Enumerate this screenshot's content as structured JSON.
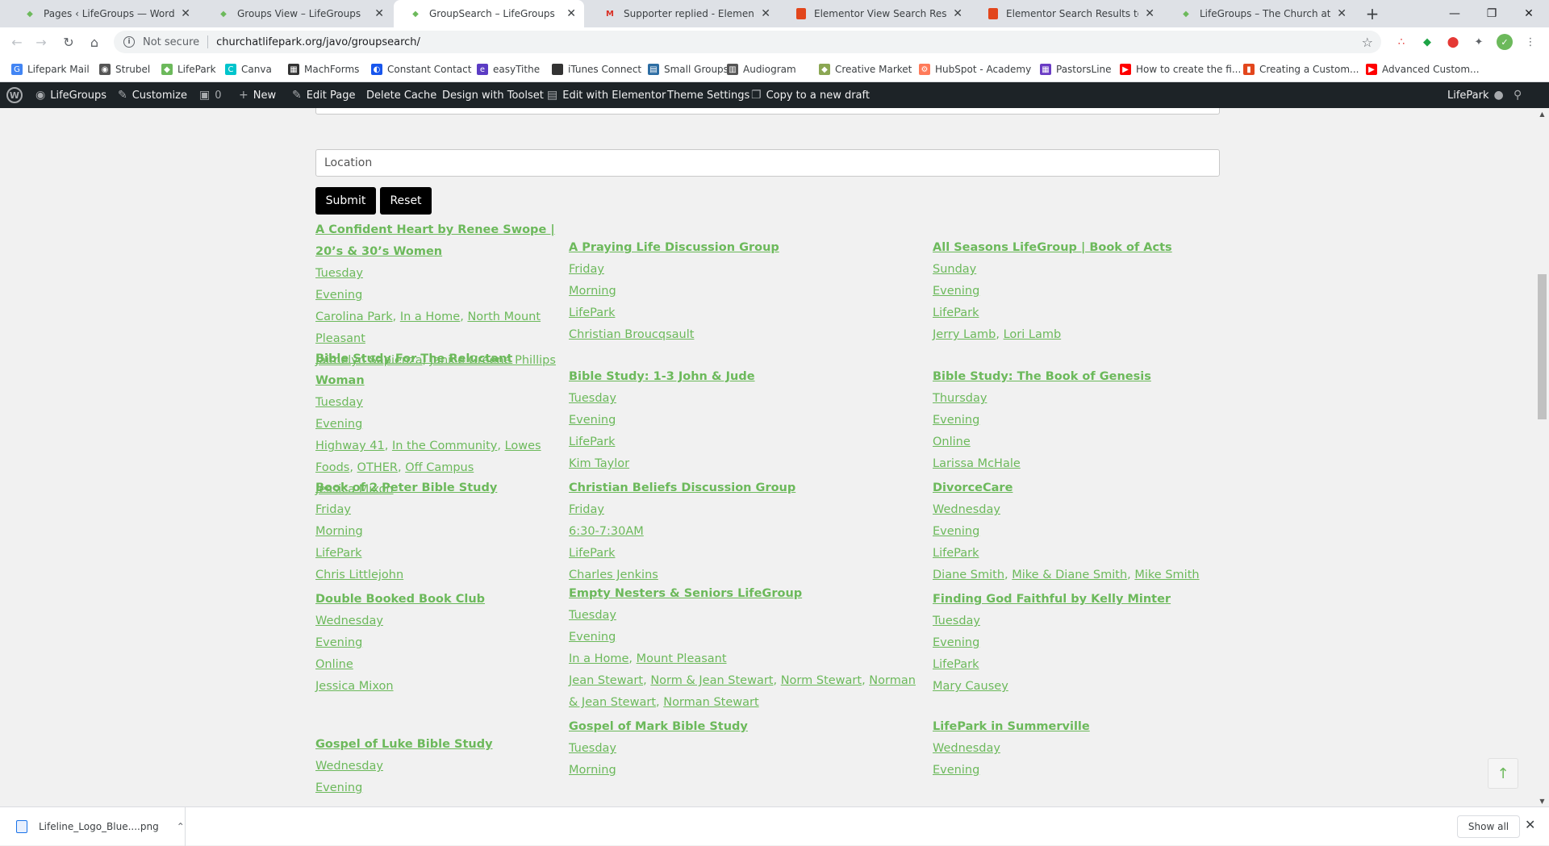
{
  "browser": {
    "tabs": [
      {
        "title": "Pages ‹ LifeGroups — WordPress",
        "icon": "wordpress-icon",
        "active": false
      },
      {
        "title": "Groups View – LifeGroups",
        "icon": "lifepark-icon",
        "active": false
      },
      {
        "title": "GroupSearch – LifeGroups",
        "icon": "lifepark-icon",
        "active": true
      },
      {
        "title": "Supporter replied - Elementor Vi",
        "icon": "gmail-icon",
        "active": false
      },
      {
        "title": "Elementor View Search Results a",
        "icon": "bookmark-red-icon",
        "active": false
      },
      {
        "title": "Elementor Search Results to a ne",
        "icon": "bookmark-red-icon",
        "active": false
      },
      {
        "title": "LifeGroups – The Church at LifeP",
        "icon": "lifepark-icon",
        "active": false
      }
    ],
    "new_tab": "+",
    "security_label": "Not secure",
    "url": "churchatlifepark.org/javo/groupsearch/",
    "bookmarks": [
      {
        "label": "Lifepark Mail",
        "color": "#4285f4",
        "glyph": "G"
      },
      {
        "label": "Strubel",
        "color": "#555555",
        "glyph": "◉"
      },
      {
        "label": "LifePark",
        "color": "#6cb95b",
        "glyph": "◆"
      },
      {
        "label": "Canva",
        "color": "#00c4cc",
        "glyph": "C"
      },
      {
        "label": "MachForms",
        "color": "#333333",
        "glyph": "▦"
      },
      {
        "label": "Constant Contact",
        "color": "#1856ed",
        "glyph": "◐"
      },
      {
        "label": "easyTithe",
        "color": "#5b3cc4",
        "glyph": "e"
      },
      {
        "label": "iTunes Connect",
        "color": "#333333",
        "glyph": ""
      },
      {
        "label": "Small Groups",
        "color": "#2d6da3",
        "glyph": "▤"
      },
      {
        "label": "Audiogram",
        "color": "#555555",
        "glyph": "▥"
      },
      {
        "label": "Creative Market",
        "color": "#8ba753",
        "glyph": "◆"
      },
      {
        "label": "HubSpot - Academy",
        "color": "#ff7a59",
        "glyph": "⚙"
      },
      {
        "label": "PastorsLine",
        "color": "#6a3cc4",
        "glyph": "▦"
      },
      {
        "label": "How to create the fi...",
        "color": "#ff0000",
        "glyph": "▶"
      },
      {
        "label": "Creating a Custom...",
        "color": "#e2461c",
        "glyph": "▮"
      },
      {
        "label": "Advanced Custom...",
        "color": "#ff0000",
        "glyph": "▶"
      }
    ]
  },
  "adminbar": {
    "site_name": "LifeGroups",
    "customize": "Customize",
    "comments_count": "0",
    "new": "New",
    "edit_page": "Edit Page",
    "delete_cache": "Delete Cache",
    "design_toolset": "Design with Toolset",
    "edit_elementor": "Edit with Elementor",
    "theme_settings": "Theme Settings",
    "copy_draft": "Copy to a new draft",
    "user": "LifePark"
  },
  "search": {
    "location_placeholder": "Location",
    "submit_label": "Submit",
    "reset_label": "Reset"
  },
  "groups": [
    {
      "title": "A Confident Heart by Renee Swope | 20’s & 30’s Women",
      "day": "Tuesday",
      "time": "Evening",
      "locations": [
        "Carolina Park",
        "In a Home",
        "North Mount Pleasant"
      ],
      "leaders": [
        "Jaimelyn Sapienza",
        "Janice Greene Phillips"
      ]
    },
    {
      "title": "A Praying Life Discussion Group",
      "day": "Friday",
      "time": "Morning",
      "locations": [
        "LifePark"
      ],
      "leaders": [
        "Christian Broucqsault"
      ]
    },
    {
      "title": "All Seasons LifeGroup | Book of Acts",
      "day": "Sunday",
      "time": "Evening",
      "locations": [
        "LifePark"
      ],
      "leaders": [
        "Jerry Lamb",
        "Lori Lamb"
      ]
    },
    {
      "title": "Bible Study For The Reluctant Woman",
      "day": "Tuesday",
      "time": "Evening",
      "locations": [
        "Highway 41",
        "In the Community",
        "Lowes Foods",
        "OTHER",
        "Off Campus"
      ],
      "leaders": [
        "Jessica Mixon"
      ]
    },
    {
      "title": "Bible Study: 1-3 John & Jude",
      "day": "Tuesday",
      "time": "Evening",
      "locations": [
        "LifePark"
      ],
      "leaders": [
        "Kim Taylor"
      ]
    },
    {
      "title": "Bible Study: The Book of Genesis",
      "day": "Thursday",
      "time": "Evening",
      "locations": [
        "Online"
      ],
      "leaders": [
        "Larissa McHale"
      ]
    },
    {
      "title": "Book of 2 Peter Bible Study",
      "day": "Friday",
      "time": "Morning",
      "locations": [
        "LifePark"
      ],
      "leaders": [
        "Chris Littlejohn"
      ]
    },
    {
      "title": "Christian Beliefs Discussion Group",
      "day": "Friday",
      "time": "6:30-7:30AM",
      "locations": [
        "LifePark"
      ],
      "leaders": [
        "Charles Jenkins"
      ]
    },
    {
      "title": "DivorceCare",
      "day": "Wednesday",
      "time": "Evening",
      "locations": [
        "LifePark"
      ],
      "leaders": [
        "Diane Smith",
        "Mike & Diane Smith",
        "Mike Smith"
      ]
    },
    {
      "title": "Double Booked Book Club",
      "day": "Wednesday",
      "time": "Evening",
      "locations": [
        "Online"
      ],
      "leaders": [
        "Jessica Mixon"
      ]
    },
    {
      "title": "Empty Nesters & Seniors LifeGroup",
      "day": "Tuesday",
      "time": "Evening",
      "locations": [
        "In a Home",
        "Mount Pleasant"
      ],
      "leaders": [
        "Jean Stewart",
        "Norm & Jean Stewart",
        "Norm Stewart",
        "Norman & Jean Stewart",
        "Norman Stewart"
      ]
    },
    {
      "title": "Finding God Faithful by Kelly Minter",
      "day": "Tuesday",
      "time": "Evening",
      "locations": [
        "LifePark"
      ],
      "leaders": [
        "Mary Causey"
      ]
    },
    {
      "title": "Gospel of Luke Bible Study",
      "day": "Wednesday",
      "time": "Evening",
      "locations": [],
      "leaders": []
    },
    {
      "title": "Gospel of Mark Bible Study",
      "day": "Tuesday",
      "time": "Morning",
      "locations": [],
      "leaders": []
    },
    {
      "title": "LifePark in Summerville",
      "day": "Wednesday",
      "time": "Evening",
      "locations": [],
      "leaders": []
    }
  ],
  "downloads": {
    "file_name": "Lifeline_Logo_Blue....png",
    "show_all": "Show all"
  },
  "colors": {
    "link_green": "#6cb95b",
    "adminbar_bg": "#1d2327",
    "button_bg": "#000000"
  }
}
